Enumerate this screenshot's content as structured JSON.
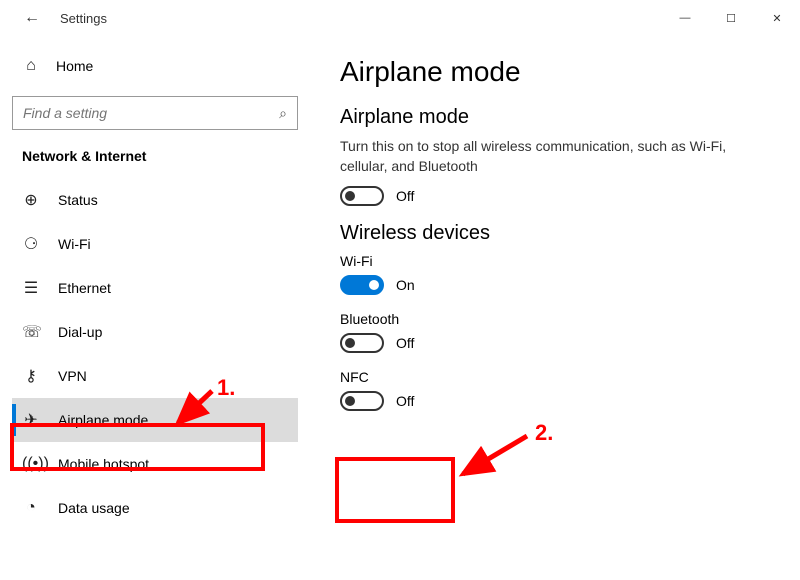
{
  "titlebar": {
    "title": "Settings",
    "back_glyph": "←",
    "min_glyph": "—",
    "max_glyph": "☐",
    "close_glyph": "✕"
  },
  "sidebar": {
    "home_icon": "⌂",
    "home_label": "Home",
    "search_placeholder": "Find a setting",
    "search_glyph": "⌕",
    "section_label": "Network & Internet",
    "items": [
      {
        "icon": "⊕",
        "label": "Status"
      },
      {
        "icon": "⚆",
        "label": "Wi-Fi"
      },
      {
        "icon": "☰",
        "label": "Ethernet"
      },
      {
        "icon": "☏",
        "label": "Dial-up"
      },
      {
        "icon": "⚷",
        "label": "VPN"
      },
      {
        "icon": "✈",
        "label": "Airplane mode"
      },
      {
        "icon": "((•))",
        "label": "Mobile hotspot"
      },
      {
        "icon": "◔",
        "label": "Data usage"
      }
    ]
  },
  "content": {
    "heading": "Airplane mode",
    "airplane": {
      "title": "Airplane mode",
      "desc": "Turn this on to stop all wireless communication, such as Wi-Fi, cellular, and Bluetooth",
      "state_label": "Off"
    },
    "wireless": {
      "title": "Wireless devices",
      "wifi_label": "Wi-Fi",
      "wifi_state": "On",
      "bluetooth_label": "Bluetooth",
      "bluetooth_state": "Off",
      "nfc_label": "NFC",
      "nfc_state": "Off"
    }
  },
  "annotations": {
    "one": "1.",
    "two": "2."
  }
}
